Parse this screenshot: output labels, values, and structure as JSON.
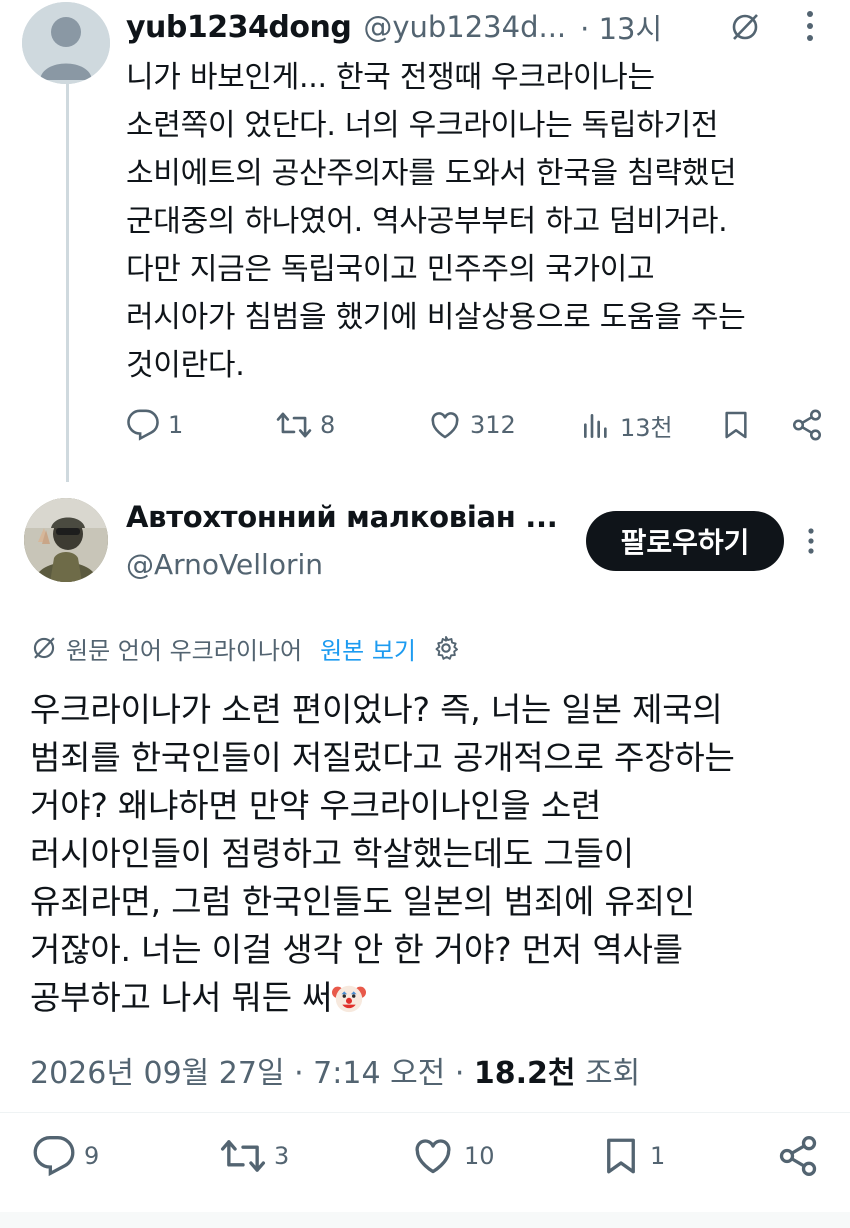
{
  "reply_tweet": {
    "display_name": "yub1234dong",
    "handle": "@yub1234d...",
    "time": "· 13시",
    "body": "니가 바보인게... 한국 전쟁때 우크라이나는\n소련쪽이 었단다. 너의 우크라이나는 독립하기전\n소비에트의 공산주의자를 도와서 한국을 침략했던\n군대중의 하나였어. 역사공부부터 하고 덤비거라.\n다만 지금은 독립국이고 민주주의 국가이고\n러시아가 침범을 했기에 비살상용으로 도움을 주는\n것이란다.",
    "actions": {
      "replies": "1",
      "retweets": "8",
      "likes": "312",
      "views": "13천"
    }
  },
  "main_tweet": {
    "display_name": "Автохтонний малковіан ...",
    "handle": "@ArnoVellorin",
    "follow_label": "팔로우하기",
    "translation_note": "원문 언어 우크라이나어",
    "view_original_label": "원본 보기",
    "body": "우크라이나가 소련 편이었나? 즉, 너는 일본 제국의\n범죄를 한국인들이 저질렀다고 공개적으로 주장하는\n거야? 왜냐하면 만약 우크라이나인을 소련\n러시아인들이 점령하고 학살했는데도 그들이\n유죄라면, 그럼 한국인들도 일본의 범죄에 유죄인\n거잖아. 너는 이걸 생각 안 한 거야? 먼저 역사를\n공부하고 나서 뭐든 써",
    "timestamp": "2026년 09월 27일 · 7:14 오전 · ",
    "views_count": "18.2천",
    "views_label": " 조회",
    "actions": {
      "replies": "9",
      "retweets": "3",
      "likes": "10",
      "bookmarks": "1"
    }
  },
  "colors": {
    "text_primary": "#0f1419",
    "text_secondary": "#536471",
    "link": "#1d9bf0",
    "thread_line": "#cfd9de",
    "button_bg": "#0f1419"
  },
  "icons": [
    "default-avatar-icon",
    "translate-icon",
    "more-icon",
    "reply-icon",
    "retweet-icon",
    "like-icon",
    "views-icon",
    "bookmark-icon",
    "share-icon",
    "gear-icon",
    "clown-emoji"
  ]
}
